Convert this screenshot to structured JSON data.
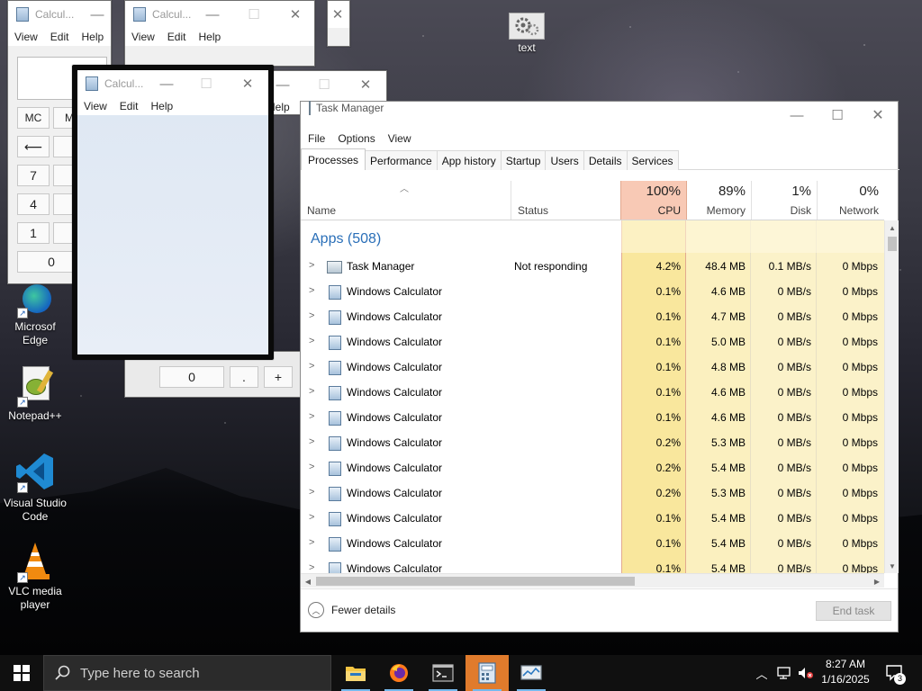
{
  "desktop": {
    "icons": [
      {
        "label": "text",
        "icon": "gear-file-icon"
      },
      {
        "label": "Microsoft Edge",
        "label_visible": "Microsof\nEdge",
        "icon": "edge-icon"
      },
      {
        "label": "Notepad++",
        "icon": "notepad-plus-plus-icon"
      },
      {
        "label": "Visual Studio Code",
        "icon": "vscode-icon"
      },
      {
        "label": "VLC media player",
        "icon": "vlc-icon"
      }
    ]
  },
  "calculator_windows": {
    "title": "Calcul...",
    "menu": [
      "View",
      "Edit",
      "Help"
    ],
    "memory_buttons": [
      "MC",
      "M"
    ],
    "buttons": {
      "back": "⟵",
      "seven": "7",
      "four": "4",
      "one": "1",
      "zero": "0",
      "dot": ".",
      "plus": "+"
    },
    "partial_menu_help": "Help"
  },
  "task_manager": {
    "title": "Task Manager",
    "menu": [
      "File",
      "Options",
      "View"
    ],
    "tabs": [
      "Processes",
      "Performance",
      "App history",
      "Startup",
      "Users",
      "Details",
      "Services"
    ],
    "active_tab": "Processes",
    "columns": {
      "name": "Name",
      "status": "Status",
      "cpu": {
        "pct": "100%",
        "label": "CPU"
      },
      "memory": {
        "pct": "89%",
        "label": "Memory"
      },
      "disk": {
        "pct": "1%",
        "label": "Disk"
      },
      "network": {
        "pct": "0%",
        "label": "Network"
      }
    },
    "group_label": "Apps (508)",
    "rows": [
      {
        "name": "Task Manager",
        "status": "Not responding",
        "cpu": "4.2%",
        "memory": "48.4 MB",
        "disk": "0.1 MB/s",
        "network": "0 Mbps",
        "icon": "task-manager-icon"
      },
      {
        "name": "Windows Calculator",
        "status": "",
        "cpu": "0.1%",
        "memory": "4.6 MB",
        "disk": "0 MB/s",
        "network": "0 Mbps",
        "icon": "calculator-icon"
      },
      {
        "name": "Windows Calculator",
        "status": "",
        "cpu": "0.1%",
        "memory": "4.7 MB",
        "disk": "0 MB/s",
        "network": "0 Mbps",
        "icon": "calculator-icon"
      },
      {
        "name": "Windows Calculator",
        "status": "",
        "cpu": "0.1%",
        "memory": "5.0 MB",
        "disk": "0 MB/s",
        "network": "0 Mbps",
        "icon": "calculator-icon"
      },
      {
        "name": "Windows Calculator",
        "status": "",
        "cpu": "0.1%",
        "memory": "4.8 MB",
        "disk": "0 MB/s",
        "network": "0 Mbps",
        "icon": "calculator-icon"
      },
      {
        "name": "Windows Calculator",
        "status": "",
        "cpu": "0.1%",
        "memory": "4.6 MB",
        "disk": "0 MB/s",
        "network": "0 Mbps",
        "icon": "calculator-icon"
      },
      {
        "name": "Windows Calculator",
        "status": "",
        "cpu": "0.1%",
        "memory": "4.6 MB",
        "disk": "0 MB/s",
        "network": "0 Mbps",
        "icon": "calculator-icon"
      },
      {
        "name": "Windows Calculator",
        "status": "",
        "cpu": "0.2%",
        "memory": "5.3 MB",
        "disk": "0 MB/s",
        "network": "0 Mbps",
        "icon": "calculator-icon"
      },
      {
        "name": "Windows Calculator",
        "status": "",
        "cpu": "0.2%",
        "memory": "5.4 MB",
        "disk": "0 MB/s",
        "network": "0 Mbps",
        "icon": "calculator-icon"
      },
      {
        "name": "Windows Calculator",
        "status": "",
        "cpu": "0.2%",
        "memory": "5.3 MB",
        "disk": "0 MB/s",
        "network": "0 Mbps",
        "icon": "calculator-icon"
      },
      {
        "name": "Windows Calculator",
        "status": "",
        "cpu": "0.1%",
        "memory": "5.4 MB",
        "disk": "0 MB/s",
        "network": "0 Mbps",
        "icon": "calculator-icon"
      },
      {
        "name": "Windows Calculator",
        "status": "",
        "cpu": "0.1%",
        "memory": "5.4 MB",
        "disk": "0 MB/s",
        "network": "0 Mbps",
        "icon": "calculator-icon"
      },
      {
        "name": "Windows Calculator",
        "status": "",
        "cpu": "0.1%",
        "memory": "5.4 MB",
        "disk": "0 MB/s",
        "network": "0 Mbps",
        "icon": "calculator-icon"
      }
    ],
    "fewer_details": "Fewer details",
    "end_task": "End task"
  },
  "taskbar": {
    "search_placeholder": "Type here to search",
    "apps": [
      "file-explorer-icon",
      "firefox-icon",
      "terminal-icon",
      "calculator-icon",
      "task-manager-icon"
    ],
    "active_app": "calculator-icon",
    "clock": {
      "time": "8:27 AM",
      "date": "1/16/2025"
    },
    "notification_count": "3"
  }
}
